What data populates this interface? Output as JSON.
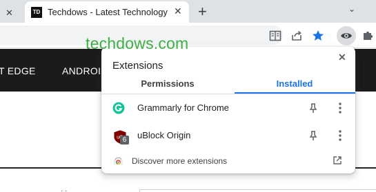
{
  "browser": {
    "tab": {
      "title": "Techdows - Latest Technology Ne",
      "favicon_text": "TD",
      "close_glyph": "✕"
    },
    "partial_tab_close": "✕",
    "new_tab_glyph": "+",
    "tab_search_glyph": "⌄",
    "toolbar_icons": [
      "reading-list-icon",
      "share-icon",
      "bookmark-star-icon",
      "eye-icon",
      "extensions-puzzle-icon"
    ],
    "accent": "#1a73e8"
  },
  "page": {
    "watermark": "techdows.com",
    "watermark_color": "#3cb043",
    "nav": {
      "items": [
        "T EDGE",
        "ANDROII"
      ]
    }
  },
  "extensions_popup": {
    "title": "Extensions",
    "close_glyph": "✕",
    "tabs": [
      {
        "label": "Permissions",
        "selected": false
      },
      {
        "label": "Installed",
        "selected": true
      }
    ],
    "installed": [
      {
        "name": "Grammarly for Chrome",
        "icon": "grammarly-icon",
        "color": "#15c39a"
      },
      {
        "name": "uBlock Origin",
        "icon": "ublock-origin-icon",
        "badge": "6",
        "color": "#800000"
      }
    ],
    "discover": {
      "label": "Discover more extensions",
      "icon": "chrome-web-store-icon"
    }
  }
}
